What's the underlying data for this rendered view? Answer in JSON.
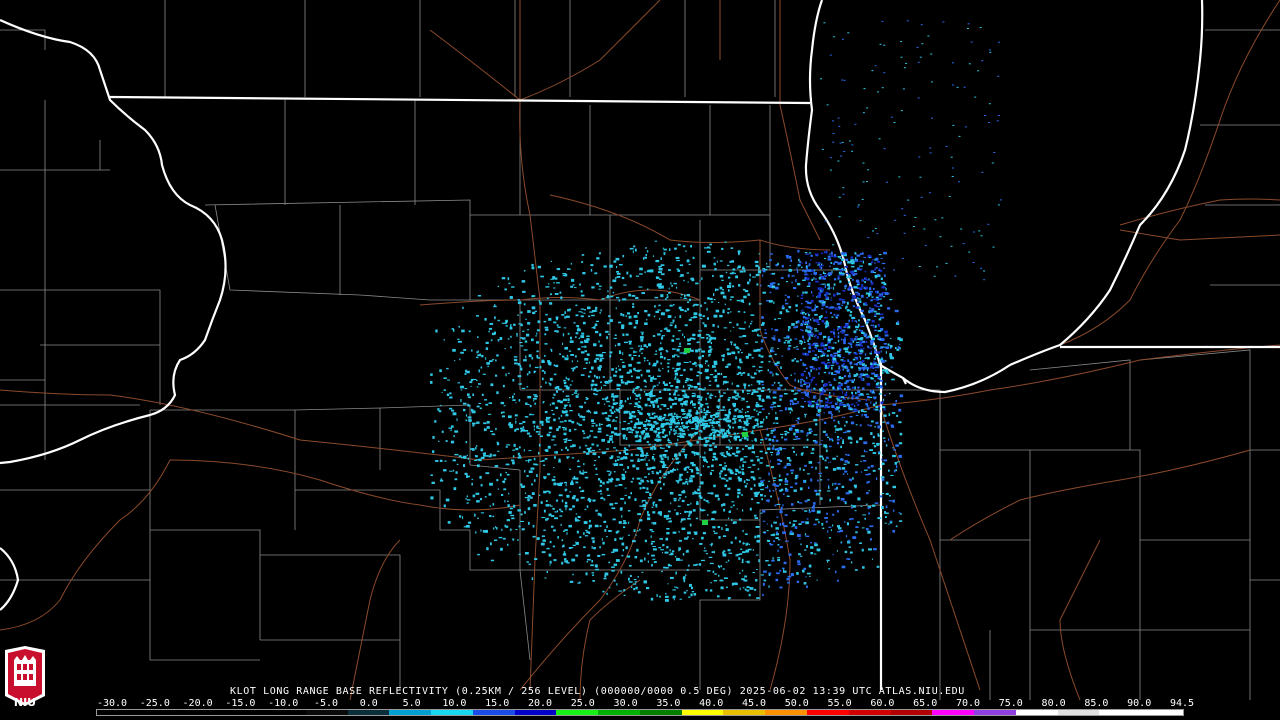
{
  "product_title": "KLOT LONG RANGE BASE REFLECTIVITY (0.25KM / 256 LEVEL) (000000/0000 0.5 DEG) 2025-06-02 13:39 UTC  ATLAS.NIU.EDU",
  "station": "KLOT",
  "product": "LONG RANGE BASE REFLECTIVITY",
  "timestamp": "2025-06-02 13:39 UTC",
  "source": "ATLAS.NIU.EDU",
  "logo_text": "NIU",
  "colorscale": {
    "labels": [
      "-30.0",
      "-25.0",
      "-20.0",
      "-15.0",
      "-10.0",
      "-5.0",
      "0.0",
      "5.0",
      "10.0",
      "15.0",
      "20.0",
      "25.0",
      "30.0",
      "35.0",
      "40.0",
      "45.0",
      "50.0",
      "55.0",
      "60.0",
      "65.0",
      "70.0",
      "75.0",
      "80.0",
      "85.0",
      "90.0",
      "94.5"
    ],
    "colors": [
      "#000000",
      "#000000",
      "#000000",
      "#000000",
      "#000000",
      "#0a0a0a",
      "#0b2f3a",
      "#00a0d0",
      "#18d8f0",
      "#1c4ce8",
      "#0000c8",
      "#18f018",
      "#00b000",
      "#008000",
      "#ffff00",
      "#e8c000",
      "#ff9000",
      "#ff0000",
      "#d00000",
      "#b00000",
      "#ff00ff",
      "#9040e0",
      "#ffffff",
      "#e0e0e0",
      "#ffffff",
      "#ffffff"
    ]
  },
  "colors": {
    "background": "#000000",
    "state_border": "#ffffff",
    "county_line": "#8a8a8a",
    "highway": "#8b4a2b",
    "echo_light": "#2ec8e6",
    "echo_medium": "#2a6cf0",
    "echo_dark": "#1830c8",
    "echo_green": "#20d040"
  },
  "icons": [
    "niu-logo-icon"
  ]
}
